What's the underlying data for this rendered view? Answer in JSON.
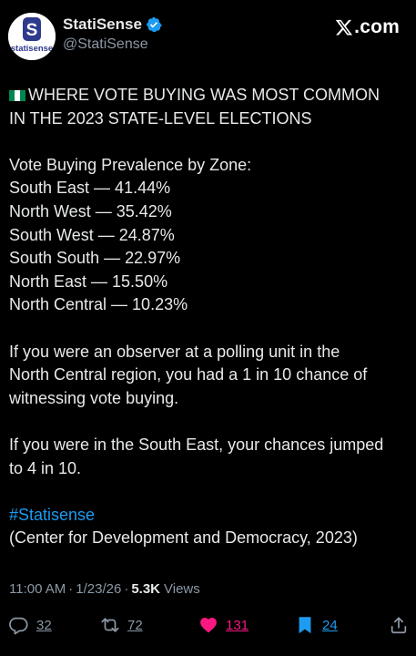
{
  "account": {
    "display_name": "StatiSense",
    "handle": "@StatiSense",
    "avatar_text": "statisense",
    "avatar_letter": "S"
  },
  "site": {
    "label": ".com"
  },
  "tweet": {
    "headline_line1": "WHERE VOTE BUYING WAS MOST COMMON",
    "headline_line2": "IN THE 2023 STATE-LEVEL ELECTIONS",
    "list_title": "Vote Buying Prevalence by Zone:",
    "zones": [
      "South East — 41.44%",
      "North West — 35.42%",
      "South West — 24.87%",
      "South South — 22.97%",
      "North East — 15.50%",
      "North Central — 10.23%"
    ],
    "para1_lines": [
      "If you were an observer at a polling unit in the",
      "North Central region, you had a 1 in 10 chance of",
      "witnessing vote buying."
    ],
    "para2_lines": [
      "If you were in the South East, your chances jumped",
      "to 4 in 10."
    ],
    "hashtag": "#Statisense",
    "source": "(Center for Development and Democracy, 2023)"
  },
  "meta": {
    "time": "11:00 AM",
    "date": "1/23/26",
    "dot": "·",
    "views_count": "5.3K",
    "views_label": "Views"
  },
  "actions": {
    "replies": "32",
    "reposts": "72",
    "likes": "131",
    "bookmarks": "24"
  },
  "colors": {
    "background": "#000000",
    "text": "#e7e9ea",
    "muted": "#8b98a5",
    "link": "#1d9bf0",
    "like": "#f91880",
    "brand": "#2e3a8c"
  },
  "icons": [
    "verified-badge-icon",
    "x-logo-icon",
    "nigeria-flag-icon",
    "reply-icon",
    "repost-icon",
    "like-heart-icon",
    "bookmark-icon",
    "share-icon"
  ]
}
